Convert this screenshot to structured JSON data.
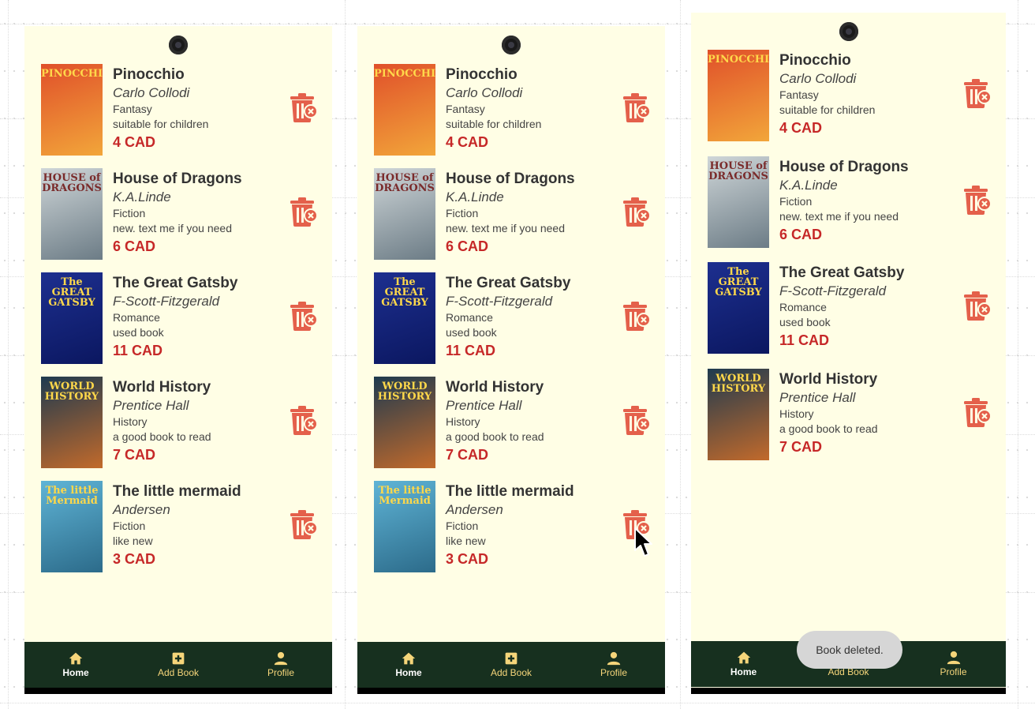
{
  "screens": [
    {
      "books": [
        {
          "title": "Pinocchio",
          "author": "Carlo Collodi",
          "genre": "Fantasy",
          "description": "suitable for children",
          "price": "4 CAD",
          "cover_text": "PINOCCHIO",
          "cover_colors": [
            "#e0502a",
            "#f2a63a"
          ]
        },
        {
          "title": "House of Dragons",
          "author": "K.A.Linde",
          "genre": "Fiction",
          "description": "new. text me if you need",
          "price": "6 CAD",
          "cover_text": "HOUSE of DRAGONS",
          "cover_colors": [
            "#cfd6d8",
            "#6c7c86"
          ]
        },
        {
          "title": "The Great Gatsby",
          "author": "F-Scott-Fitzgerald",
          "genre": "Romance",
          "description": "used book",
          "price": "11 CAD",
          "cover_text": "The GREAT GATSBY",
          "cover_colors": [
            "#1d2f8f",
            "#0b1760"
          ]
        },
        {
          "title": "World History",
          "author": "Prentice Hall",
          "genre": "History",
          "description": "a good book to read",
          "price": "7 CAD",
          "cover_text": "WORLD HISTORY",
          "cover_colors": [
            "#1e3a4f",
            "#c26a2b"
          ]
        },
        {
          "title": "The little mermaid",
          "author": "Andersen",
          "genre": "Fiction",
          "description": "like new",
          "price": "3 CAD",
          "cover_text": "The little Mermaid",
          "cover_colors": [
            "#5fb4d6",
            "#2c6b8a"
          ]
        }
      ]
    },
    {
      "books": [
        {
          "title": "Pinocchio",
          "author": "Carlo Collodi",
          "genre": "Fantasy",
          "description": "suitable for children",
          "price": "4 CAD",
          "cover_text": "PINOCCHIO",
          "cover_colors": [
            "#e0502a",
            "#f2a63a"
          ]
        },
        {
          "title": "House of Dragons",
          "author": "K.A.Linde",
          "genre": "Fiction",
          "description": "new. text me if you need",
          "price": "6 CAD",
          "cover_text": "HOUSE of DRAGONS",
          "cover_colors": [
            "#cfd6d8",
            "#6c7c86"
          ]
        },
        {
          "title": "The Great Gatsby",
          "author": "F-Scott-Fitzgerald",
          "genre": "Romance",
          "description": "used book",
          "price": "11 CAD",
          "cover_text": "The GREAT GATSBY",
          "cover_colors": [
            "#1d2f8f",
            "#0b1760"
          ]
        },
        {
          "title": "World History",
          "author": "Prentice Hall",
          "genre": "History",
          "description": "a good book to read",
          "price": "7 CAD",
          "cover_text": "WORLD HISTORY",
          "cover_colors": [
            "#1e3a4f",
            "#c26a2b"
          ]
        },
        {
          "title": "The little mermaid",
          "author": "Andersen",
          "genre": "Fiction",
          "description": "like new",
          "price": "3 CAD",
          "cover_text": "The little Mermaid",
          "cover_colors": [
            "#5fb4d6",
            "#2c6b8a"
          ]
        }
      ]
    },
    {
      "books": [
        {
          "title": "Pinocchio",
          "author": "Carlo Collodi",
          "genre": "Fantasy",
          "description": "suitable for children",
          "price": "4 CAD",
          "cover_text": "PINOCCHIO",
          "cover_colors": [
            "#e0502a",
            "#f2a63a"
          ]
        },
        {
          "title": "House of Dragons",
          "author": "K.A.Linde",
          "genre": "Fiction",
          "description": "new. text me if you need",
          "price": "6 CAD",
          "cover_text": "HOUSE of DRAGONS",
          "cover_colors": [
            "#cfd6d8",
            "#6c7c86"
          ]
        },
        {
          "title": "The Great Gatsby",
          "author": "F-Scott-Fitzgerald",
          "genre": "Romance",
          "description": "used book",
          "price": "11 CAD",
          "cover_text": "The GREAT GATSBY",
          "cover_colors": [
            "#1d2f8f",
            "#0b1760"
          ]
        },
        {
          "title": "World History",
          "author": "Prentice Hall",
          "genre": "History",
          "description": "a good book to read",
          "price": "7 CAD",
          "cover_text": "WORLD HISTORY",
          "cover_colors": [
            "#1e3a4f",
            "#c26a2b"
          ]
        }
      ],
      "toast": "Book deleted."
    }
  ],
  "nav": {
    "home_label": "Home",
    "add_label": "Add Book",
    "profile_label": "Profile",
    "home_icon": "home-icon",
    "add_icon": "add-box-icon",
    "profile_icon": "person-icon"
  },
  "delete_icon": "trash-delete-icon",
  "colors": {
    "background": "#fffee5",
    "price": "#c62828",
    "delete": "#e4604b",
    "nav_bg": "#17301f",
    "nav_text": "#f5d57a"
  }
}
